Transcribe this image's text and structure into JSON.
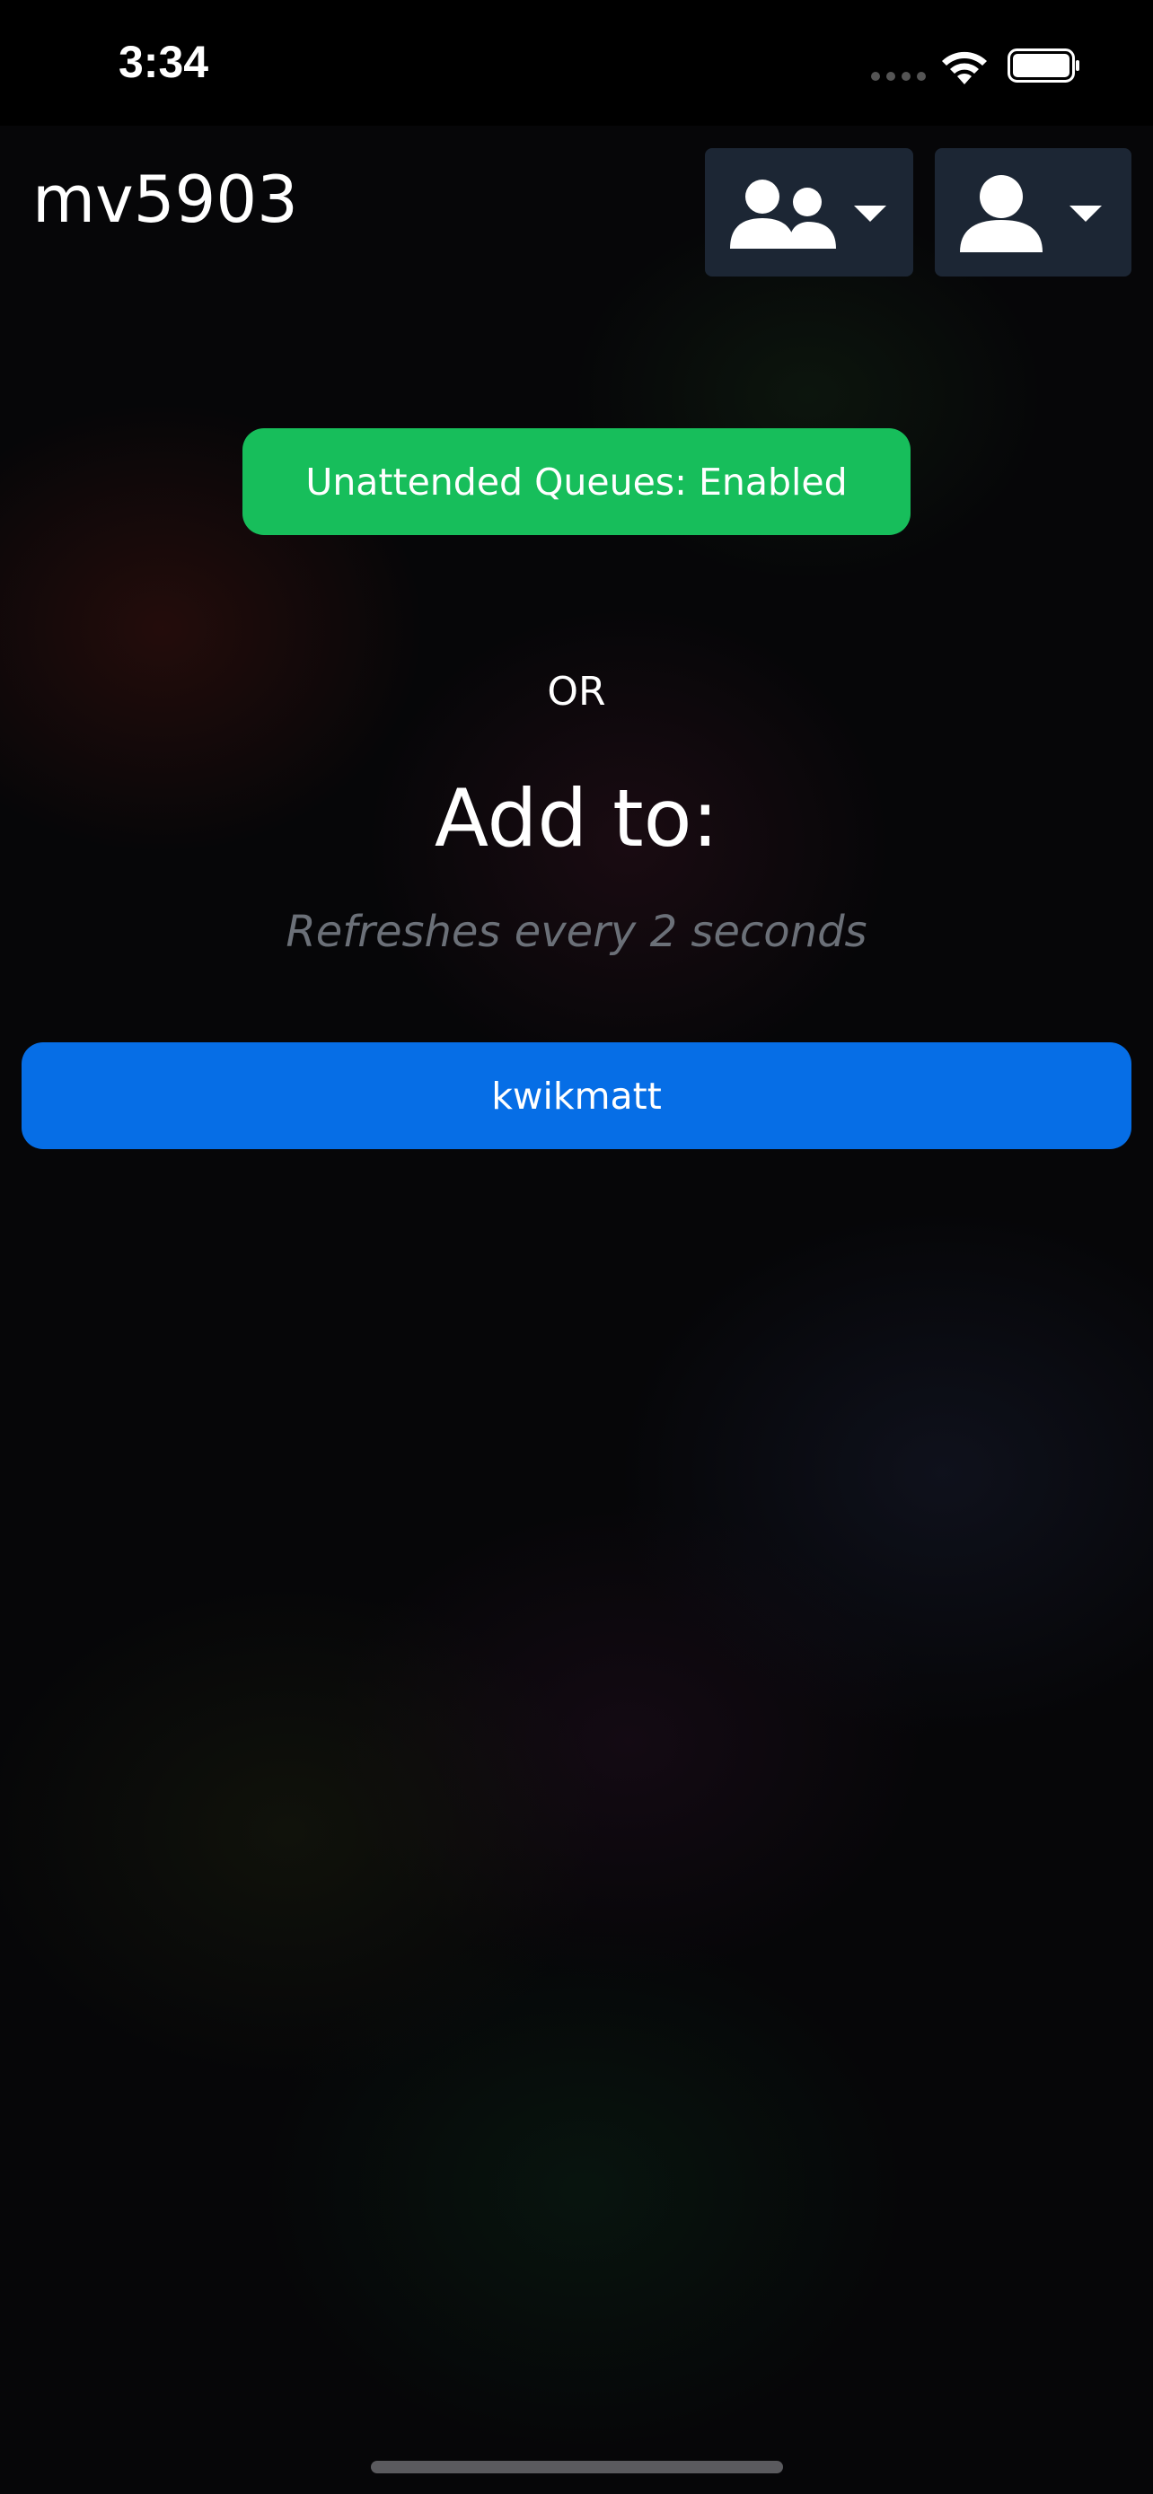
{
  "status_bar": {
    "time": "3:34",
    "icons": [
      "signal-icon",
      "wifi-icon",
      "battery-icon"
    ]
  },
  "header": {
    "title": "mv5903",
    "buttons": [
      {
        "icon": "users-icon",
        "dropdown_icon": "caret-down-icon"
      },
      {
        "icon": "user-icon",
        "dropdown_icon": "caret-down-icon"
      }
    ]
  },
  "main": {
    "unattended_status": "Unattended Queues: Enabled",
    "or_label": "OR",
    "add_to_title": "Add to:",
    "refresh_note": "Refreshes every 2 seconds",
    "queues": [
      {
        "label": "kwikmatt"
      }
    ]
  },
  "colors": {
    "background": "#000000",
    "status_green": "#17be5b",
    "primary_blue": "#066ee6",
    "header_button_bg": "#1c2634",
    "muted_text": "#6b7078"
  }
}
